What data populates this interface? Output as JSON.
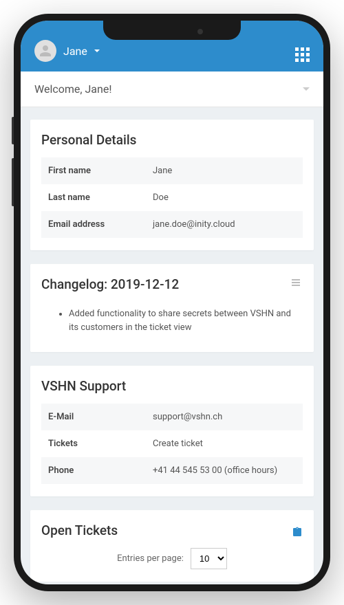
{
  "header": {
    "username": "Jane"
  },
  "welcome": {
    "text": "Welcome, Jane!"
  },
  "personal_details": {
    "title": "Personal Details",
    "rows": [
      {
        "label": "First name",
        "value": "Jane"
      },
      {
        "label": "Last name",
        "value": "Doe"
      },
      {
        "label": "Email address",
        "value": "jane.doe@inity.cloud"
      }
    ]
  },
  "changelog": {
    "title": "Changelog: 2019-12-12",
    "items": [
      "Added functionality to share secrets between VSHN and its customers in the ticket view"
    ]
  },
  "support": {
    "title": "VSHN Support",
    "rows": [
      {
        "label": "E-Mail",
        "value": "support@vshn.ch",
        "link": true
      },
      {
        "label": "Tickets",
        "value": "Create ticket",
        "link": true
      },
      {
        "label": "Phone",
        "value": "+41 44 545 53 00 (office hours)",
        "link": true
      }
    ]
  },
  "open_tickets": {
    "title": "Open Tickets",
    "pager_label": "Entries per page:",
    "pager_value": "10"
  }
}
